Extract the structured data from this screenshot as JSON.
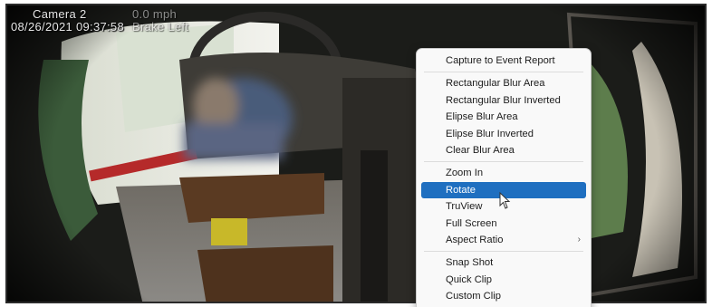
{
  "overlay": {
    "camera": "Camera 2",
    "rate": "0.0 mph",
    "timestamp": "08/26/2021 09:37:58",
    "extra": "Brake Left"
  },
  "context_menu": {
    "groups": [
      [
        {
          "label": "Capture to Event Report"
        }
      ],
      [
        {
          "label": "Rectangular Blur Area"
        },
        {
          "label": "Rectangular Blur Inverted"
        },
        {
          "label": "Elipse Blur Area"
        },
        {
          "label": "Elipse Blur Inverted"
        },
        {
          "label": "Clear Blur Area"
        }
      ],
      [
        {
          "label": "Zoom In"
        },
        {
          "label": "Rotate",
          "selected": true
        },
        {
          "label": "TruView"
        },
        {
          "label": "Full Screen"
        },
        {
          "label": "Aspect Ratio",
          "has_submenu": true,
          "submenu_glyph": "›"
        }
      ],
      [
        {
          "label": "Snap Shot"
        },
        {
          "label": "Quick Clip"
        },
        {
          "label": "Custom Clip"
        }
      ]
    ]
  },
  "colors": {
    "selection": "#1f6fc0",
    "menu_background": "#f9f9f9",
    "seat": "#5a3a22",
    "frame_border": "#2a2a2a"
  }
}
